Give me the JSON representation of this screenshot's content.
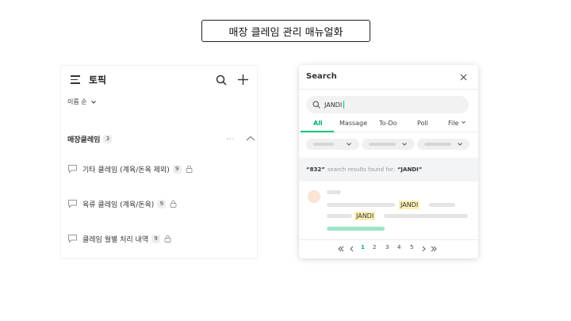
{
  "header": {
    "title": "매장 클레임 관리 매뉴얼화"
  },
  "topics": {
    "title": "토픽",
    "sort_label": "이름 순",
    "folder": {
      "name": "매장클레임",
      "count": "3",
      "more": "···"
    },
    "items": [
      {
        "label": "기타 클레임 (계육/돈육 제외)",
        "count": "9"
      },
      {
        "label": "육류 클레임 (계육/돈육)",
        "count": "9"
      },
      {
        "label": "클레임 월별 처리 내역",
        "count": "9"
      }
    ]
  },
  "search": {
    "title": "Search",
    "query": "JANDI",
    "tabs": [
      "All",
      "Massage",
      "To-Do",
      "Poll",
      "File"
    ],
    "active_tab": "All",
    "results_count": "“832”",
    "results_text": "search results found for:",
    "results_query": "“JANDI”",
    "highlight_1": "JANDI",
    "highlight_2": "JANDI",
    "pages": [
      "1",
      "2",
      "3",
      "4",
      "5"
    ],
    "active_page": "1"
  },
  "colors": {
    "accent": "#00c473",
    "highlight": "#fdf0b6",
    "avatar": "#fbe3d5"
  },
  "icons": [
    "hamburger-icon",
    "search-icon",
    "plus-icon",
    "chevron-down-icon",
    "more-icon",
    "chevron-up-icon",
    "chat-icon",
    "lock-icon",
    "close-icon",
    "first-page-icon",
    "prev-page-icon",
    "next-page-icon",
    "last-page-icon"
  ]
}
